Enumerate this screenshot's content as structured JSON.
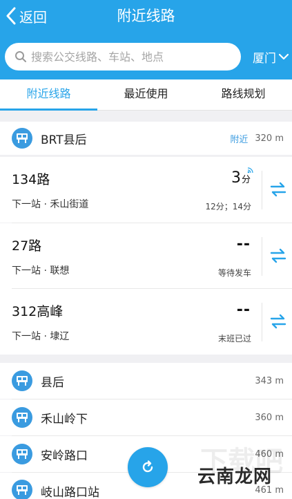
{
  "header": {
    "back_label": "返回",
    "title": "附近线路",
    "city": "厦门"
  },
  "search": {
    "placeholder": "搜索公交线路、车站、地点"
  },
  "tabs": [
    {
      "label": "附近线路",
      "active": true
    },
    {
      "label": "最近使用",
      "active": false
    },
    {
      "label": "路线规划",
      "active": false
    }
  ],
  "main_station": {
    "name": "BRT县后",
    "tag": "附近",
    "distance": "320 m"
  },
  "routes": [
    {
      "name": "134路",
      "next_stop": "下一站 · 禾山街道",
      "eta_value": "3",
      "eta_unit": "分",
      "eta_note": "12分；14分"
    },
    {
      "name": "27路",
      "next_stop": "下一站 · 联想",
      "eta_value": "--",
      "eta_unit": "",
      "eta_note": "等待发车"
    },
    {
      "name": "312高峰",
      "next_stop": "下一站 · 埭辽",
      "eta_value": "--",
      "eta_unit": "",
      "eta_note": "末班已过"
    }
  ],
  "other_stations": [
    {
      "name": "县后",
      "distance": "343 m"
    },
    {
      "name": "禾山岭下",
      "distance": "360 m"
    },
    {
      "name": "安岭路口",
      "distance": "460 m"
    },
    {
      "name": "岐山路口站",
      "distance": "461 m"
    }
  ],
  "watermark": {
    "text": "云南龙网"
  },
  "colors": {
    "primary": "#27a4e9",
    "station_icon": "#3a9be0",
    "background": "#f0f0f3"
  }
}
